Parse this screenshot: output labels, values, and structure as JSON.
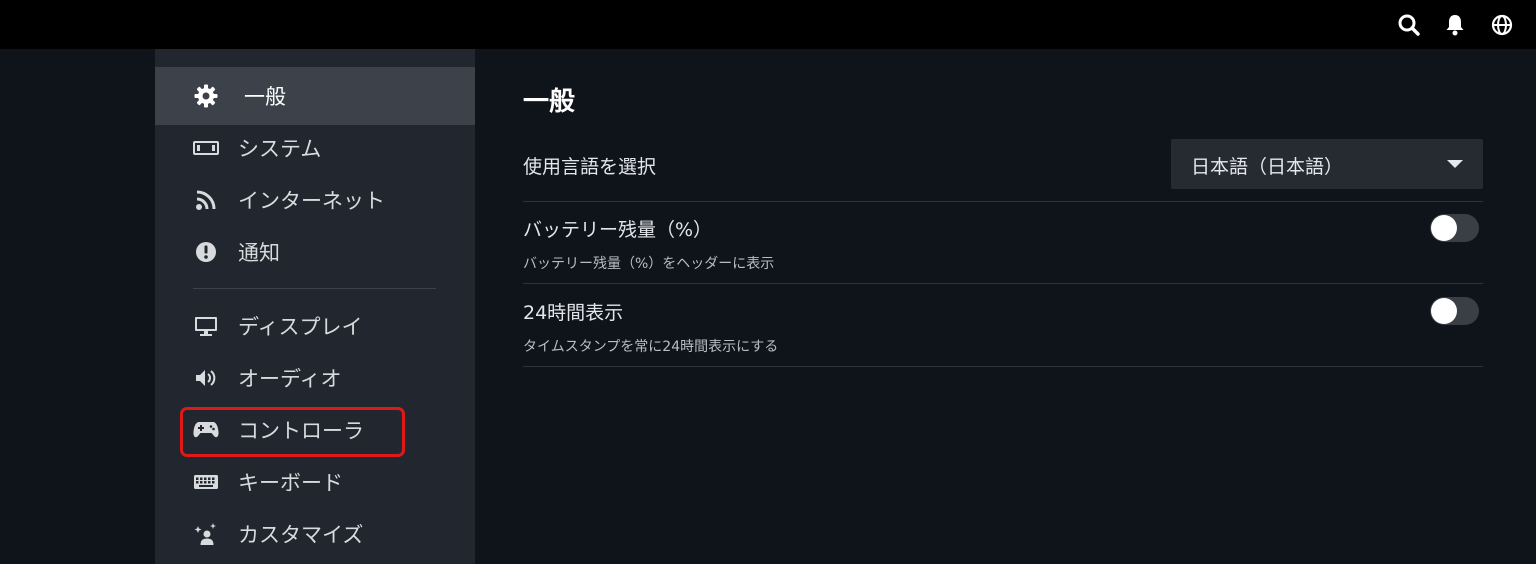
{
  "topbar": {
    "icons": [
      "search-icon",
      "bell-icon",
      "globe-icon"
    ]
  },
  "sidebar": {
    "items": [
      {
        "label": "一般",
        "icon": "gear-icon",
        "active": true
      },
      {
        "label": "システム",
        "icon": "battery-icon"
      },
      {
        "label": "インターネット",
        "icon": "rss-icon"
      },
      {
        "label": "通知",
        "icon": "exclamation-icon"
      },
      {
        "label": "ディスプレイ",
        "icon": "monitor-icon"
      },
      {
        "label": "オーディオ",
        "icon": "speaker-icon"
      },
      {
        "label": "コントローラ",
        "icon": "gamepad-icon",
        "highlighted": true
      },
      {
        "label": "キーボード",
        "icon": "keyboard-icon"
      },
      {
        "label": "カスタマイズ",
        "icon": "sparkle-person-icon"
      }
    ],
    "highlight_color": "#e01818"
  },
  "main": {
    "title": "一般",
    "language": {
      "label": "使用言語を選択",
      "value": "日本語（日本語）"
    },
    "battery": {
      "label": "バッテリー残量（%）",
      "description": "バッテリー残量（%）をヘッダーに表示",
      "enabled": false
    },
    "clock24": {
      "label": "24時間表示",
      "description": "タイムスタンプを常に24時間表示にする",
      "enabled": false
    }
  }
}
